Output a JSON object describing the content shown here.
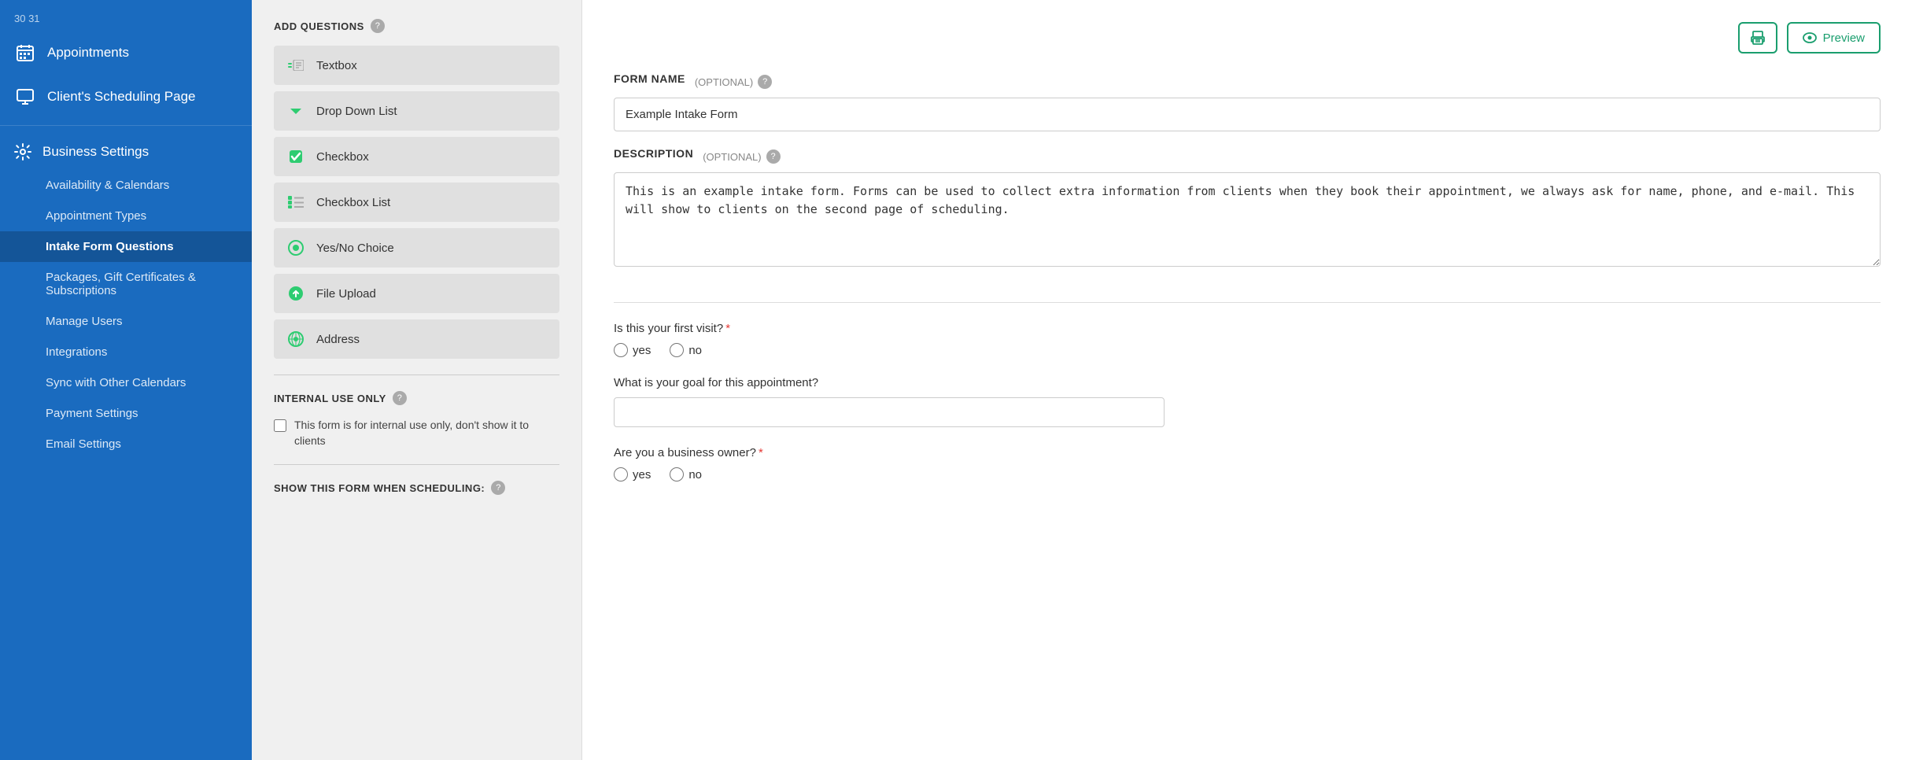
{
  "sidebar": {
    "date_label": "30  31",
    "nav_items": [
      {
        "id": "appointments",
        "label": "Appointments"
      },
      {
        "id": "clients-scheduling",
        "label": "Client's Scheduling Page"
      }
    ],
    "business_settings": {
      "label": "Business Settings",
      "sub_items": [
        {
          "id": "availability-calendars",
          "label": "Availability & Calendars",
          "active": false
        },
        {
          "id": "appointment-types",
          "label": "Appointment Types",
          "active": false
        },
        {
          "id": "intake-form-questions",
          "label": "Intake Form Questions",
          "active": true
        },
        {
          "id": "packages-gift",
          "label": "Packages, Gift Certificates & Subscriptions",
          "active": false
        },
        {
          "id": "manage-users",
          "label": "Manage Users",
          "active": false
        },
        {
          "id": "integrations",
          "label": "Integrations",
          "active": false
        },
        {
          "id": "sync-calendars",
          "label": "Sync with Other Calendars",
          "active": false
        },
        {
          "id": "payment-settings",
          "label": "Payment Settings",
          "active": false
        },
        {
          "id": "email-settings",
          "label": "Email Settings",
          "active": false
        }
      ]
    }
  },
  "left_panel": {
    "add_questions_label": "ADD QUESTIONS",
    "question_types": [
      {
        "id": "textbox",
        "label": "Textbox",
        "icon": "textbox"
      },
      {
        "id": "dropdown",
        "label": "Drop Down List",
        "icon": "dropdown"
      },
      {
        "id": "checkbox",
        "label": "Checkbox",
        "icon": "checkbox"
      },
      {
        "id": "checkbox-list",
        "label": "Checkbox List",
        "icon": "checkbox-list"
      },
      {
        "id": "yes-no",
        "label": "Yes/No Choice",
        "icon": "yes-no"
      },
      {
        "id": "file-upload",
        "label": "File Upload",
        "icon": "file-upload"
      },
      {
        "id": "address",
        "label": "Address",
        "icon": "address"
      }
    ],
    "internal_use_label": "INTERNAL USE ONLY",
    "internal_use_checkbox_label": "This form is for internal use only, don't show it to clients",
    "show_form_label": "SHOW THIS FORM WHEN SCHEDULING:"
  },
  "right_panel": {
    "preview_btn_label": "Preview",
    "print_btn_label": "",
    "form_name_label": "FORM NAME",
    "form_name_optional": "(OPTIONAL)",
    "form_name_placeholder": "Example Intake Form",
    "form_name_value": "Example Intake Form",
    "description_label": "DESCRIPTION",
    "description_optional": "(OPTIONAL)",
    "description_value": "This is an example intake form. Forms can be used to collect extra information from clients when they book their appointment, we always ask for name, phone, and e-mail. This will show to clients on the second page of scheduling.",
    "questions": [
      {
        "id": "q1",
        "text": "Is this your first visit?",
        "required": true,
        "type": "yes-no",
        "options": [
          "yes",
          "no"
        ]
      },
      {
        "id": "q2",
        "text": "What is your goal for this appointment?",
        "required": false,
        "type": "textbox"
      },
      {
        "id": "q3",
        "text": "Are you a business owner?",
        "required": true,
        "type": "yes-no",
        "options": [
          "yes",
          "no"
        ]
      }
    ]
  }
}
